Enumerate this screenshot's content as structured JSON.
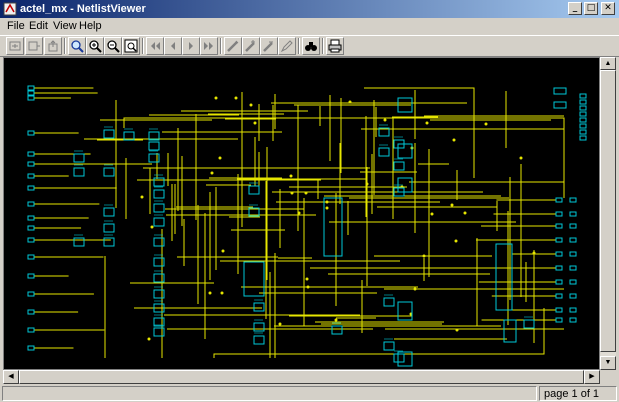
{
  "window": {
    "title": "actel_mx - NetlistViewer"
  },
  "menu": {
    "items": [
      "File",
      "Edit",
      "View",
      "Help"
    ]
  },
  "toolbar": {
    "buttons": [
      "fit-window",
      "zoom-in-box",
      "export",
      "zoom-select",
      "zoom-in",
      "zoom-out",
      "zoom-fit",
      "page-first",
      "page-prev",
      "page-next",
      "page-last",
      "probe",
      "probe-add",
      "probe-remove",
      "pencil",
      "find",
      "print"
    ]
  },
  "status": {
    "page": "page 1 of 1"
  },
  "colors": {
    "wire": "#e6e600",
    "component": "#00c8d8",
    "background": "#000000",
    "titlebar_start": "#0a246a",
    "titlebar_end": "#a6caf0"
  }
}
